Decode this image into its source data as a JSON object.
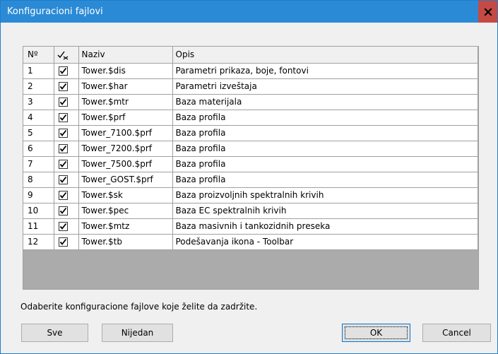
{
  "window": {
    "title": "Konfiguracioni fajlovi",
    "close_glyph": "x"
  },
  "grid": {
    "columns": {
      "num": "Nº",
      "check_icon": "check-all-toggle-icon",
      "name": "Naziv",
      "desc": "Opis"
    },
    "rows": [
      {
        "num": "1",
        "checked": true,
        "name": "Tower.$dis",
        "desc": "Parametri prikaza, boje, fontovi"
      },
      {
        "num": "2",
        "checked": true,
        "name": "Tower.$har",
        "desc": "Parametri izveštaja"
      },
      {
        "num": "3",
        "checked": true,
        "name": "Tower.$mtr",
        "desc": "Baza materijala"
      },
      {
        "num": "4",
        "checked": true,
        "name": "Tower.$prf",
        "desc": "Baza profila"
      },
      {
        "num": "5",
        "checked": true,
        "name": "Tower_7100.$prf",
        "desc": "Baza profila"
      },
      {
        "num": "6",
        "checked": true,
        "name": "Tower_7200.$prf",
        "desc": "Baza profila"
      },
      {
        "num": "7",
        "checked": true,
        "name": "Tower_7500.$prf",
        "desc": "Baza profila"
      },
      {
        "num": "8",
        "checked": true,
        "name": "Tower_GOST.$prf",
        "desc": "Baza profila"
      },
      {
        "num": "9",
        "checked": true,
        "name": "Tower.$sk",
        "desc": "Baza proizvoljnih spektralnih krivih"
      },
      {
        "num": "10",
        "checked": true,
        "name": "Tower.$pec",
        "desc": "Baza EC spektralnih krivih"
      },
      {
        "num": "11",
        "checked": true,
        "name": "Tower.$mtz",
        "desc": "Baza masivnih i tankozidnih preseka"
      },
      {
        "num": "12",
        "checked": true,
        "name": "Tower.$tb",
        "desc": "Podešavanja ikona - Toolbar"
      }
    ]
  },
  "hint": "Odaberite konfiguracione fajlove koje želite da zadržite.",
  "buttons": {
    "all": "Sve",
    "none": "Nijedan",
    "ok": "OK",
    "cancel": "Cancel"
  },
  "colors": {
    "titlebar": "#2b8ad6",
    "close": "#c64a44",
    "dialog_bg": "#f0f0f0",
    "grid_bg": "#ababab"
  }
}
